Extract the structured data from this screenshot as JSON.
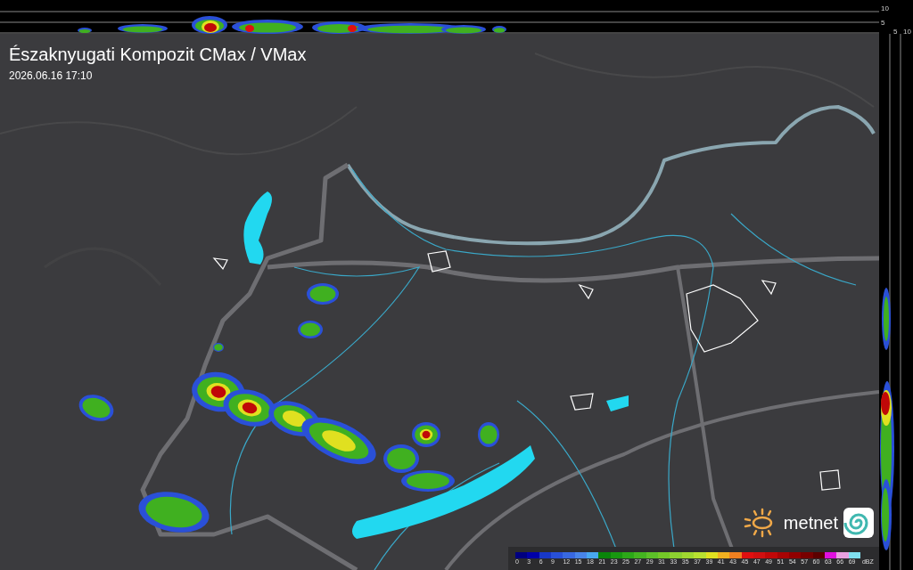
{
  "title": "Északnyugati Kompozit CMax / VMax",
  "timestamp": "2026.06.16 17:10",
  "top_profile": {
    "ticks": [
      "10",
      "5"
    ]
  },
  "side_profile": {
    "ticks": [
      "5",
      "10"
    ]
  },
  "brand": {
    "name": "metnet"
  },
  "legend": {
    "unit": "dBZ",
    "steps": [
      {
        "label": "0",
        "color": "#000080"
      },
      {
        "label": "3",
        "color": "#0000a8"
      },
      {
        "label": "6",
        "color": "#1838c8"
      },
      {
        "label": "9",
        "color": "#2850d8"
      },
      {
        "label": "12",
        "color": "#3868e0"
      },
      {
        "label": "15",
        "color": "#4884e8"
      },
      {
        "label": "18",
        "color": "#48a8f0"
      },
      {
        "label": "21",
        "color": "#0a840a"
      },
      {
        "label": "23",
        "color": "#189810"
      },
      {
        "label": "25",
        "color": "#2ca818"
      },
      {
        "label": "27",
        "color": "#44b420"
      },
      {
        "label": "29",
        "color": "#5cc028"
      },
      {
        "label": "31",
        "color": "#74c828"
      },
      {
        "label": "33",
        "color": "#8cd030"
      },
      {
        "label": "35",
        "color": "#a0d830"
      },
      {
        "label": "37",
        "color": "#b8e030"
      },
      {
        "label": "39",
        "color": "#e0e020"
      },
      {
        "label": "41",
        "color": "#f0b020"
      },
      {
        "label": "43",
        "color": "#f08020"
      },
      {
        "label": "45",
        "color": "#e01010"
      },
      {
        "label": "47",
        "color": "#d01010"
      },
      {
        "label": "49",
        "color": "#c00808"
      },
      {
        "label": "51",
        "color": "#a80404"
      },
      {
        "label": "54",
        "color": "#900000"
      },
      {
        "label": "57",
        "color": "#780000"
      },
      {
        "label": "60",
        "color": "#5c0000"
      },
      {
        "label": "63",
        "color": "#e010e0"
      },
      {
        "label": "66",
        "color": "#e8a0e0"
      },
      {
        "label": "69",
        "color": "#80e0f0"
      }
    ]
  }
}
